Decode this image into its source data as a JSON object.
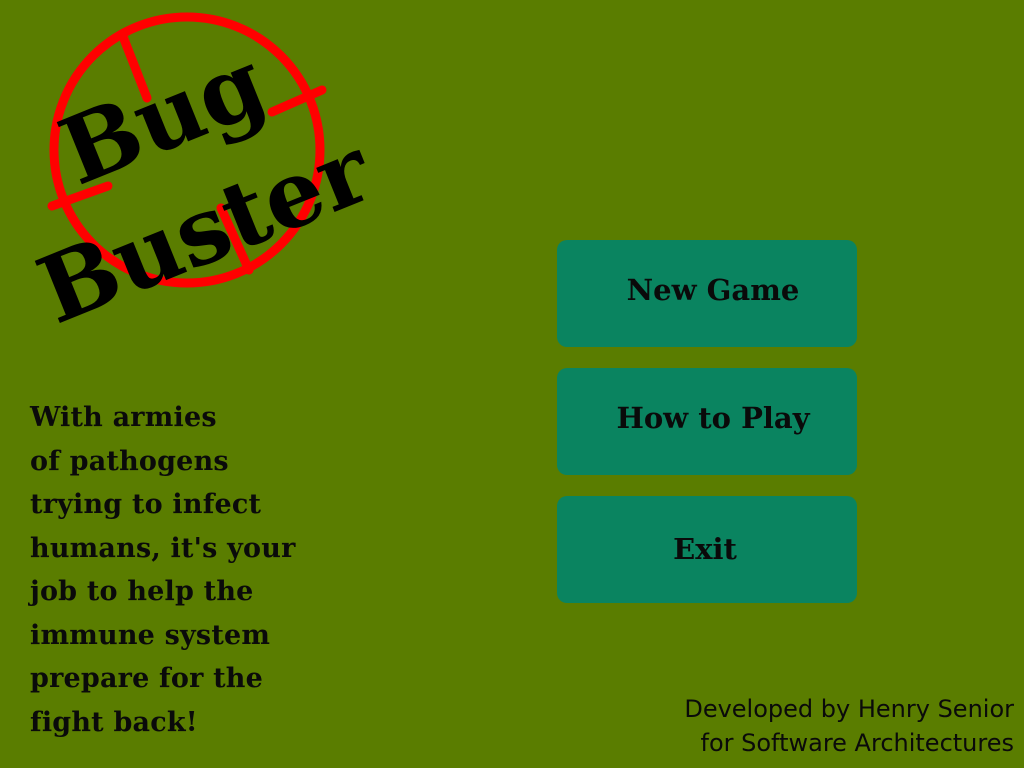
{
  "logo": {
    "line1": "Bug",
    "line2": "Buster",
    "crosshair_color": "#ff0000"
  },
  "intro": {
    "lines": [
      "With armies",
      "of pathogens",
      "trying to infect",
      "humans, it's your",
      "job to help the",
      "immune system",
      "prepare for the",
      "fight back!"
    ]
  },
  "menu": {
    "new_game": "New Game",
    "how_to_play": "How to Play",
    "exit": "Exit"
  },
  "credits": {
    "line1": "Developed by Henry Senior",
    "line2": "for Software Architectures"
  },
  "colors": {
    "background": "#5a7d00",
    "button": "#0a8460",
    "text": "#0a0a0a"
  }
}
